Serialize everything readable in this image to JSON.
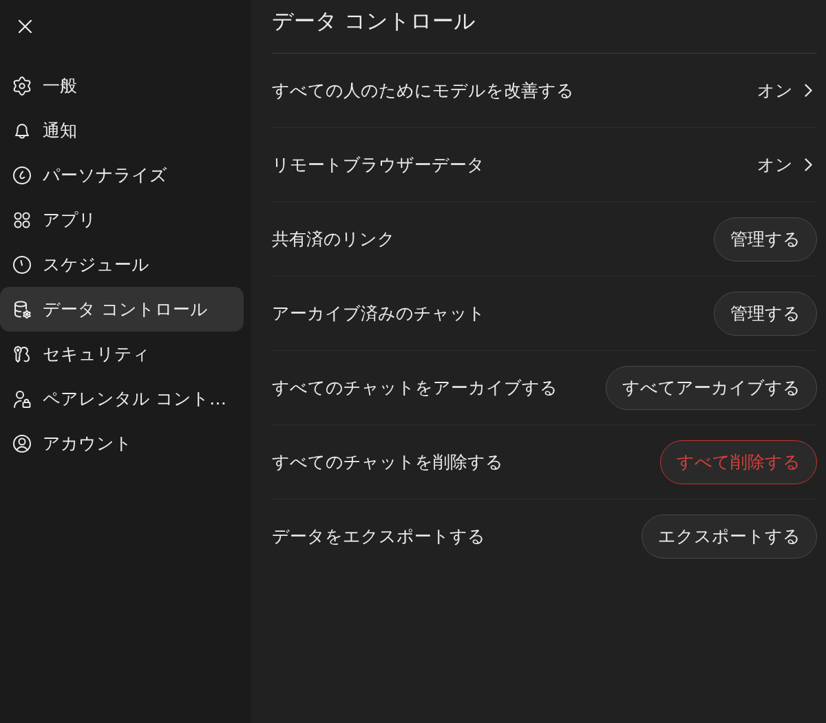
{
  "sidebar": {
    "items": [
      {
        "label": "一般",
        "selected": false
      },
      {
        "label": "通知",
        "selected": false
      },
      {
        "label": "パーソナライズ",
        "selected": false
      },
      {
        "label": "アプリ",
        "selected": false
      },
      {
        "label": "スケジュール",
        "selected": false
      },
      {
        "label": "データ コントロール",
        "selected": true
      },
      {
        "label": "セキュリティ",
        "selected": false
      },
      {
        "label": "ペアレンタル コント…",
        "selected": false
      },
      {
        "label": "アカウント",
        "selected": false
      }
    ]
  },
  "panel": {
    "title": "データ コントロール",
    "rows": [
      {
        "kind": "value",
        "label": "すべての人のためにモデルを改善する",
        "value": "オン"
      },
      {
        "kind": "value",
        "label": "リモートブラウザーデータ",
        "value": "オン"
      },
      {
        "kind": "button",
        "label": "共有済のリンク",
        "button": "管理する"
      },
      {
        "kind": "button",
        "label": "アーカイブ済みのチャット",
        "button": "管理する"
      },
      {
        "kind": "button",
        "label": "すべてのチャットをアーカイブする",
        "button": "すべてアーカイブする"
      },
      {
        "kind": "danger",
        "label": "すべてのチャットを削除する",
        "button": "すべて削除する"
      },
      {
        "kind": "button",
        "label": "データをエクスポートする",
        "button": "エクスポートする"
      }
    ]
  }
}
